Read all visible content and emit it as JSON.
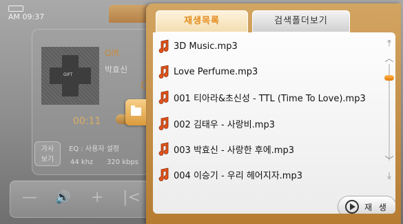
{
  "status": {
    "time": "AM 09:37"
  },
  "player": {
    "album_art_text": "GIFT",
    "song_title": "Gift",
    "artist": "박효신",
    "current_time": "00:11",
    "lyrics_button": [
      "가사",
      "보기"
    ],
    "eq_label": "EQ : 사용자 설정",
    "sample_rate": "44 khz",
    "bitrate": "320 kbps",
    "controls": [
      "—",
      "🔊",
      "+",
      "|<"
    ]
  },
  "tabs": {
    "playlist": "재생목록",
    "folder_view": "검색폴더보기"
  },
  "playlist": {
    "items": [
      {
        "label": "3D Music.mp3"
      },
      {
        "label": "Love Perfume.mp3"
      },
      {
        "label": "001 티아라&초신성 - TTL (Time To Love).mp3"
      },
      {
        "label": "002 김태우 - 사랑비.mp3"
      },
      {
        "label": "003 박효신 - 사랑한 후에.mp3"
      },
      {
        "label": "004 이승기 - 우리 헤어지자.mp3"
      }
    ],
    "play_button_label": "재 생"
  },
  "icons": {
    "note": "music-note-icon",
    "play": "play-circle-icon",
    "folder": "folder-icon",
    "scroll_top": "scroll-top-icon",
    "scroll_up": "scroll-up-icon",
    "scroll_down": "scroll-down-icon",
    "scroll_bottom": "scroll-bottom-icon"
  },
  "colors": {
    "accent": "#e58a1a",
    "note": "#e4541b",
    "panel": "#c48d45"
  }
}
